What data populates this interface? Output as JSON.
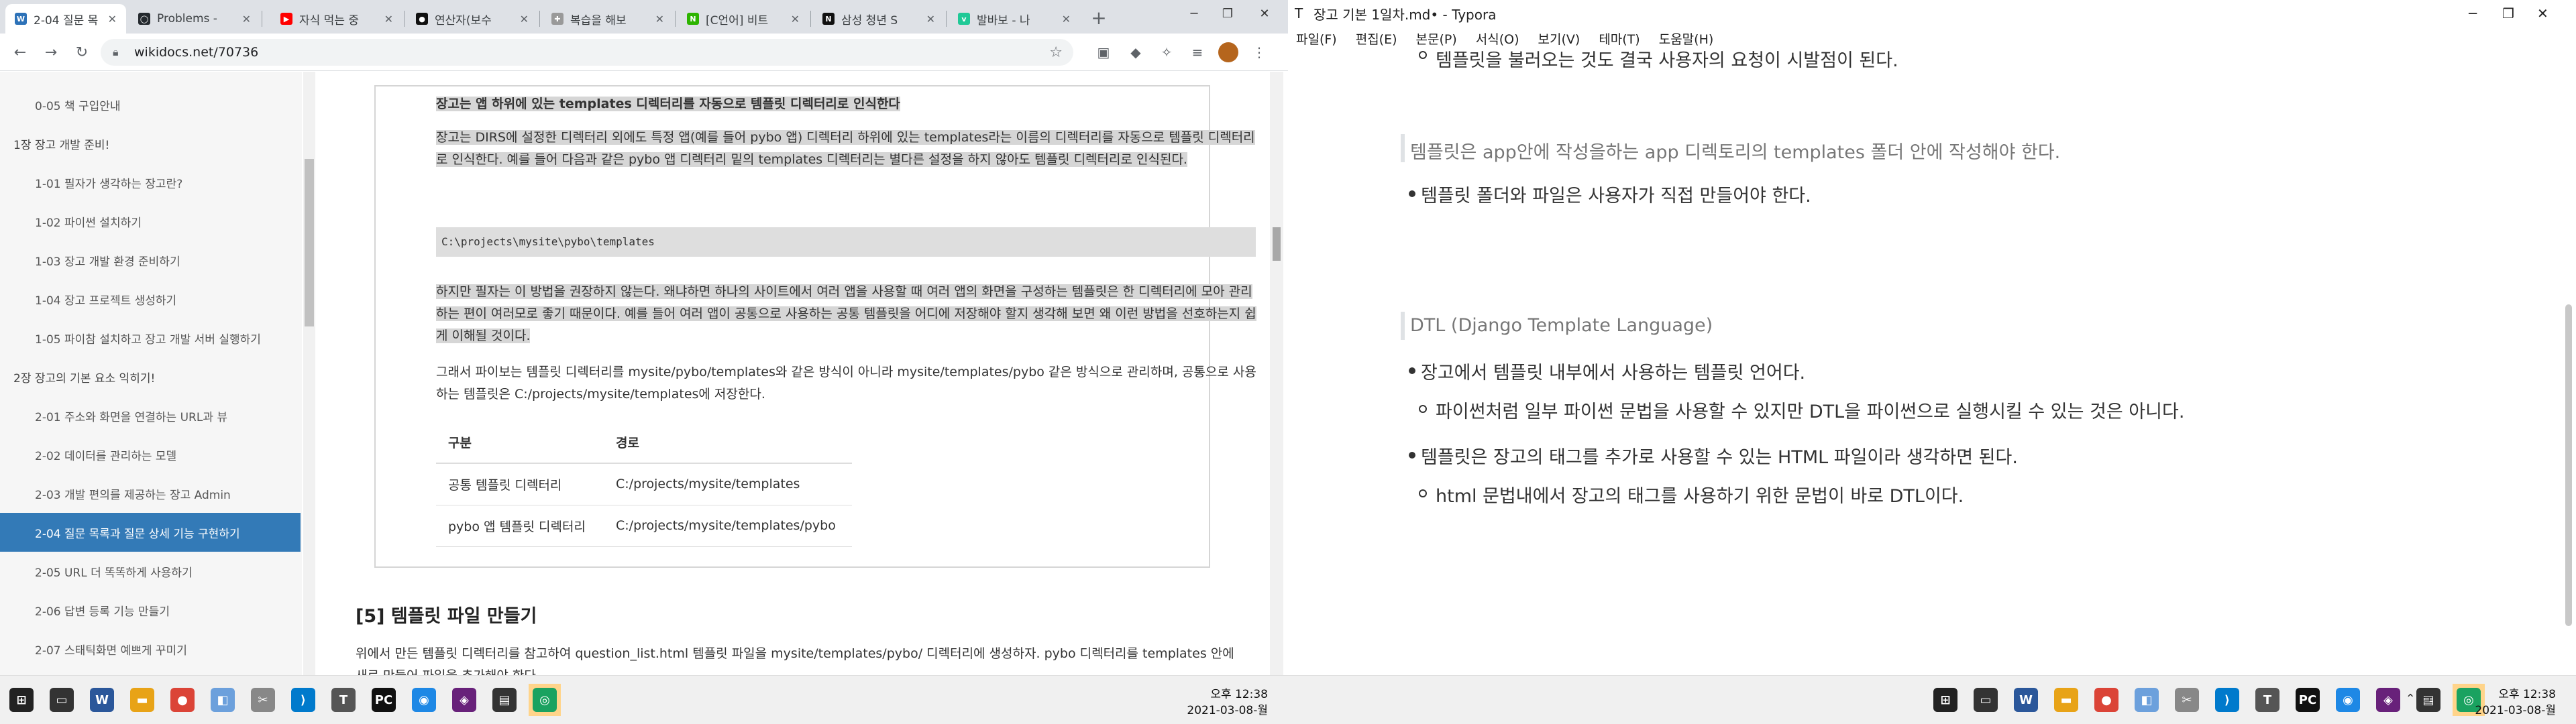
{
  "left": {
    "tabs": [
      {
        "label": "2-04 질문 목",
        "icon": "wikidocs-icon",
        "color": "#2d72b8"
      },
      {
        "label": "Problems - ",
        "icon": "github-icon",
        "color": "#24292e"
      },
      {
        "label": "자식 먹는 중",
        "icon": "youtube-icon",
        "color": "#ff0000"
      },
      {
        "label": "연산자(보수",
        "icon": "notion-icon",
        "color": "#111111"
      },
      {
        "label": "복습을 해보",
        "icon": "tistory-icon",
        "color": "#666666"
      },
      {
        "label": "[C언어] 비트",
        "icon": "naver-icon",
        "color": "#2db400"
      },
      {
        "label": "삼성 청년 S",
        "icon": "notion-icon",
        "color": "#111111"
      },
      {
        "label": "발바보 - 나",
        "icon": "velog-icon",
        "color": "#20c997"
      }
    ],
    "url": "wikidocs.net/70736",
    "sidebar": {
      "items": [
        {
          "label": "0-05 책 구입안내",
          "chapter": false
        },
        {
          "label": "1장 장고 개발 준비!",
          "chapter": true
        },
        {
          "label": "1-01 필자가 생각하는 장고란?",
          "chapter": false
        },
        {
          "label": "1-02 파이썬 설치하기",
          "chapter": false
        },
        {
          "label": "1-03 장고 개발 환경 준비하기",
          "chapter": false
        },
        {
          "label": "1-04 장고 프로젝트 생성하기",
          "chapter": false
        },
        {
          "label": "1-05 파이참 설치하고 장고 개발 서버 실행하기",
          "chapter": false
        },
        {
          "label": "2장 장고의 기본 요소 익히기!",
          "chapter": true
        },
        {
          "label": "2-01 주소와 화면을 연결하는 URL과 뷰",
          "chapter": false
        },
        {
          "label": "2-02 데이터를 관리하는 모델",
          "chapter": false
        },
        {
          "label": "2-03 개발 편의를 제공하는 장고 Admin",
          "chapter": false
        },
        {
          "label": "2-04 질문 목록과 질문 상세 기능 구현하기",
          "chapter": false,
          "active": true
        },
        {
          "label": "2-05 URL 더 똑똑하게 사용하기",
          "chapter": false
        },
        {
          "label": "2-06 답변 등록 기능 만들기",
          "chapter": false
        },
        {
          "label": "2-07 스태틱화면 예쁘게 꾸미기",
          "chapter": false
        }
      ]
    },
    "doc": {
      "box_heading": "장고는 앱 하위에 있는 templates 디렉터리를 자동으로 템플릿 디렉터리로 인식한다",
      "p1": "장고는 DIRS에 설정한 디렉터리 외에도 특정 앱(예를 들어 pybo 앱) 디렉터리 하위에 있는 templates라는 이름의 디렉터리를 자동으로 템플릿 디렉터리로 인식한다. 예를 들어 다음과 같은 pybo 앱 디렉터리 밑의 templates 디렉터리는 별다른 설정을 하지 않아도 템플릿 디렉터리로 인식된다.",
      "code": "C:\\projects\\mysite\\pybo\\templates",
      "p2": "하지만 필자는 이 방법을 권장하지 않는다. 왜냐하면 하나의 사이트에서 여러 앱을 사용할 때 여러 앱의 화면을 구성하는 템플릿은 한 디렉터리에 모아 관리하는 편이 여러모로 좋기 때문이다. 예를 들어 여러 앱이 공통으로 사용하는 공통 템플릿을 어디에 저장해야 할지 생각해 보면 왜 이런 방법을 선호하는지 쉽게 이해될 것이다.",
      "p3": "그래서 파이보는 템플릿 디렉터리를 mysite/pybo/templates와 같은 방식이 아니라 mysite/templates/pybo 같은 방식으로 관리하며, 공통으로 사용하는 템플릿은 C:/projects/mysite/templates에 저장한다.",
      "table": {
        "headers": [
          "구분",
          "경로"
        ],
        "rows": [
          [
            "공통 템플릿 디렉터리",
            "C:/projects/mysite/templates"
          ],
          [
            "pybo 앱 템플릿 디렉터리",
            "C:/projects/mysite/templates/pybo"
          ]
        ]
      },
      "section_title": "[5] 템플릿 파일 만들기",
      "p4": "위에서 만든 템플릿 디렉터리를 참고하여 question_list.html 템플릿 파일을 mysite/templates/pybo/ 디렉터리에 생성하자. pybo 디렉터리를 templates 안에 새로 만들어 파일을 추가해야 한다."
    },
    "clock": {
      "time": "오후 12:38",
      "date": "2021-03-08-월"
    }
  },
  "right": {
    "title": "장고 기본 1일차.md• - Typora",
    "menu": [
      "파일(F)",
      "편집(E)",
      "본문(P)",
      "서식(O)",
      "보기(V)",
      "테마(T)",
      "도움말(H)"
    ],
    "lines": {
      "l1": "템플릿을 불러오는 것도 결국 사용자의 요청이 시발점이 된다.",
      "q1": "템플릿은 app안에 작성을하는 app 디렉토리의 templates 폴더 안에 작성해야 한다.",
      "l2": "템플릿 폴더와 파일은 사용자가 직접 만들어야 한다.",
      "q2": "DTL (Django Template Language)",
      "l3": "장고에서 템플릿 내부에서 사용하는 템플릿 언어다.",
      "l4": "파이썬처럼 일부 파이썬 문법을 사용할 수 있지만 DTL을 파이썬으로 실행시킬 수 있는 것은 아니다.",
      "l5": "템플릿은 장고의 태그를 추가로 사용할 수 있는 HTML 파일이라 생각하면 된다.",
      "l6": "html 문법내에서 장고의 태그를 사용하기 위한 문법이 바로 DTL이다."
    },
    "clock": {
      "time": "오후 12:38",
      "date": "2021-03-08-월"
    }
  },
  "taskbar_icons": [
    {
      "name": "windows-start-icon",
      "color": "#222222",
      "glyph": "⊞"
    },
    {
      "name": "task-view-icon",
      "color": "#333333",
      "glyph": "▭"
    },
    {
      "name": "word-icon",
      "color": "#2b579a",
      "glyph": "W"
    },
    {
      "name": "file-explorer-icon",
      "color": "#e8a317",
      "glyph": "▬"
    },
    {
      "name": "chrome-icon",
      "color": "#db4437",
      "glyph": "●"
    },
    {
      "name": "snip-icon",
      "color": "#6ca0dc",
      "glyph": "◧"
    },
    {
      "name": "tool-icon",
      "color": "#888888",
      "glyph": "✂"
    },
    {
      "name": "vscode-icon",
      "color": "#007acc",
      "glyph": "⟩"
    },
    {
      "name": "typora-icon",
      "color": "#555555",
      "glyph": "T"
    },
    {
      "name": "pycharm-icon",
      "color": "#111111",
      "glyph": "PC"
    },
    {
      "name": "app-icon",
      "color": "#1e88e5",
      "glyph": "◉"
    },
    {
      "name": "visual-studio-icon",
      "color": "#68217a",
      "glyph": "◈"
    },
    {
      "name": "notes-icon",
      "color": "#333333",
      "glyph": "▤"
    },
    {
      "name": "browser-app-icon",
      "color": "#1aa260",
      "glyph": "◎"
    }
  ]
}
